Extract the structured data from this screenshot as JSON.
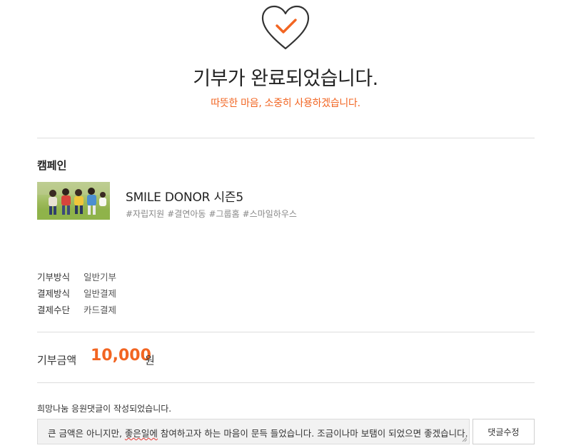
{
  "result": {
    "title": "기부가 완료되었습니다.",
    "subtitle": "따뜻한 마음, 소중히 사용하겠습니다."
  },
  "campaign": {
    "section_title": "캠페인",
    "name": "SMILE DONOR 시즌5",
    "tags": [
      "#자립지원",
      "#결연아동",
      "#그룹홈",
      "#스마일하우스"
    ]
  },
  "details": [
    {
      "label": "기부방식",
      "value": "일반기부"
    },
    {
      "label": "결제방식",
      "value": "일반결제"
    },
    {
      "label": "결제수단",
      "value": "카드결제"
    }
  ],
  "amount": {
    "label": "기부금액",
    "value": "10,000",
    "unit": "원"
  },
  "comment": {
    "notice": "희망나눔 응원댓글이 작성되었습니다.",
    "text_before": "큰 금액은 아니지만, ",
    "text_spell": "좋은일에",
    "text_after": " 참여하고자 하는 마음이 문득 들었습니다. 조금이나마 보탬이 되었으면 좋겠습니다.",
    "edit_button": "댓글수정"
  },
  "colors": {
    "accent": "#f26522",
    "heart_outline": "#333333"
  }
}
